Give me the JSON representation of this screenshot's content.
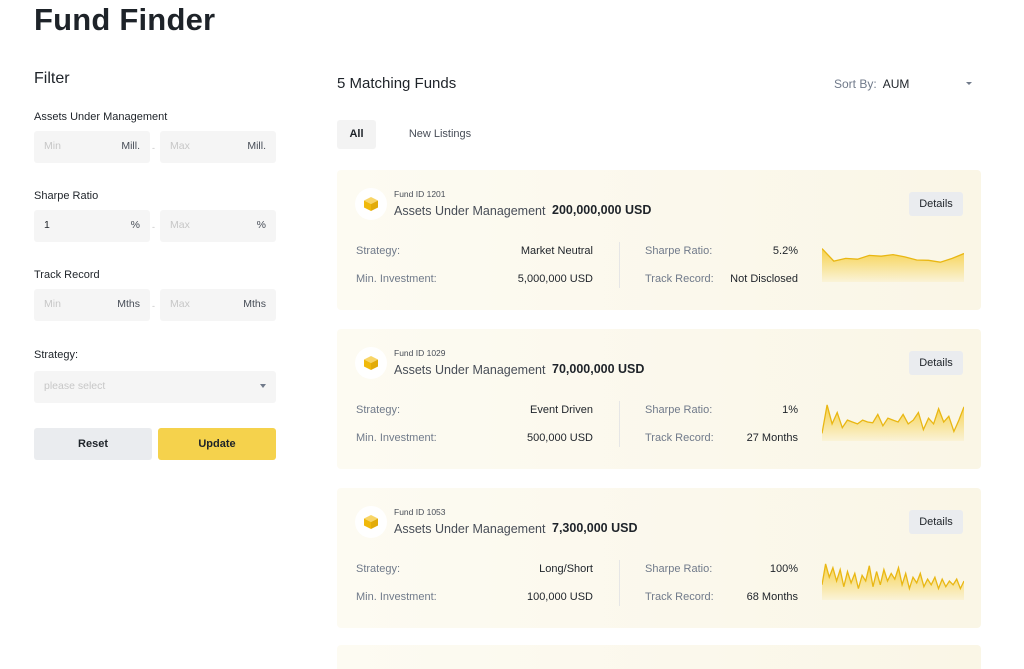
{
  "page": {
    "title": "Fund Finder"
  },
  "filter": {
    "title": "Filter",
    "aum": {
      "label": "Assets Under Management",
      "min_placeholder": "Min",
      "max_placeholder": "Max",
      "unit": "Mill."
    },
    "sharpe": {
      "label": "Sharpe Ratio",
      "min_value": "1",
      "max_placeholder": "Max",
      "unit": "%"
    },
    "track": {
      "label": "Track Record",
      "min_placeholder": "Min",
      "max_placeholder": "Max",
      "unit": "Mths"
    },
    "strategy": {
      "label": "Strategy:",
      "placeholder": "please select"
    },
    "dash": "-",
    "reset_label": "Reset",
    "update_label": "Update"
  },
  "main": {
    "heading": "5 Matching Funds",
    "sort_label": "Sort By:",
    "sort_value": "AUM",
    "tabs": [
      {
        "label": "All"
      },
      {
        "label": "New Listings"
      }
    ]
  },
  "card_labels": {
    "aum": "Assets Under Management",
    "strategy": "Strategy:",
    "min_inv": "Min. Investment:",
    "sharpe": "Sharpe Ratio:",
    "track": "Track Record:",
    "details": "Details"
  },
  "funds": [
    {
      "fund_id": "Fund ID 1201",
      "aum": "200,000,000 USD",
      "strategy": "Market Neutral",
      "min_investment": "5,000,000 USD",
      "sharpe": "5.2%",
      "track_record": "Not Disclosed",
      "spark": [
        0.88,
        0.55,
        0.62,
        0.6,
        0.7,
        0.68,
        0.72,
        0.66,
        0.58,
        0.57,
        0.52,
        0.62,
        0.75
      ]
    },
    {
      "fund_id": "Fund ID 1029",
      "aum": "70,000,000 USD",
      "strategy": "Event Driven",
      "min_investment": "500,000 USD",
      "sharpe": "1%",
      "track_record": "27 Months",
      "spark": [
        0.2,
        0.95,
        0.45,
        0.75,
        0.35,
        0.55,
        0.5,
        0.45,
        0.55,
        0.5,
        0.48,
        0.7,
        0.4,
        0.6,
        0.55,
        0.5,
        0.7,
        0.45,
        0.55,
        0.75,
        0.3,
        0.6,
        0.45,
        0.85,
        0.5,
        0.65,
        0.25,
        0.55,
        0.9
      ]
    },
    {
      "fund_id": "Fund ID 1053",
      "aum": "7,300,000 USD",
      "strategy": "Long/Short",
      "min_investment": "100,000 USD",
      "sharpe": "100%",
      "track_record": "68 Months",
      "spark": [
        0.4,
        0.95,
        0.6,
        0.85,
        0.5,
        0.8,
        0.35,
        0.75,
        0.45,
        0.7,
        0.3,
        0.65,
        0.5,
        0.9,
        0.35,
        0.75,
        0.4,
        0.8,
        0.5,
        0.7,
        0.55,
        0.85,
        0.4,
        0.7,
        0.3,
        0.6,
        0.45,
        0.7,
        0.35,
        0.55,
        0.4,
        0.6,
        0.3,
        0.55,
        0.35,
        0.5,
        0.4,
        0.55,
        0.3,
        0.5
      ]
    }
  ]
}
